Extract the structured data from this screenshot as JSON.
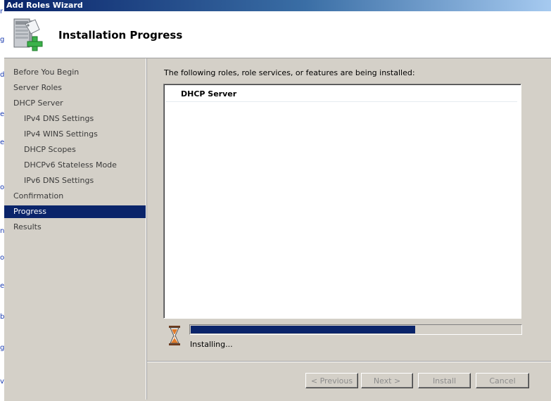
{
  "window": {
    "title": "Add Roles Wizard"
  },
  "header": {
    "title": "Installation Progress",
    "icon": "server-roles-add-icon"
  },
  "nav": {
    "items": [
      {
        "label": "Before You Begin",
        "level": 0,
        "selected": false
      },
      {
        "label": "Server Roles",
        "level": 0,
        "selected": false
      },
      {
        "label": "DHCP Server",
        "level": 0,
        "selected": false
      },
      {
        "label": "IPv4 DNS Settings",
        "level": 1,
        "selected": false
      },
      {
        "label": "IPv4 WINS Settings",
        "level": 1,
        "selected": false
      },
      {
        "label": "DHCP Scopes",
        "level": 1,
        "selected": false
      },
      {
        "label": "DHCPv6 Stateless Mode",
        "level": 1,
        "selected": false
      },
      {
        "label": "IPv6 DNS Settings",
        "level": 1,
        "selected": false
      },
      {
        "label": "Confirmation",
        "level": 0,
        "selected": false
      },
      {
        "label": "Progress",
        "level": 0,
        "selected": true
      },
      {
        "label": "Results",
        "level": 0,
        "selected": false
      }
    ]
  },
  "content": {
    "intro": "The following roles, role services, or features are being installed:",
    "roles": [
      "DHCP Server"
    ],
    "progress_fraction": 0.68,
    "status": "Installing..."
  },
  "buttons": {
    "previous": "< Previous",
    "next": "Next >",
    "install": "Install",
    "cancel": "Cancel"
  },
  "background_fragments": [
    "r",
    "g",
    "d",
    "e",
    "e",
    "ol",
    "n",
    "o",
    "e",
    "b",
    "g",
    "v"
  ],
  "colors": {
    "selection": "#0a246a",
    "progress": "#0a246a",
    "face": "#d4d0c8"
  }
}
